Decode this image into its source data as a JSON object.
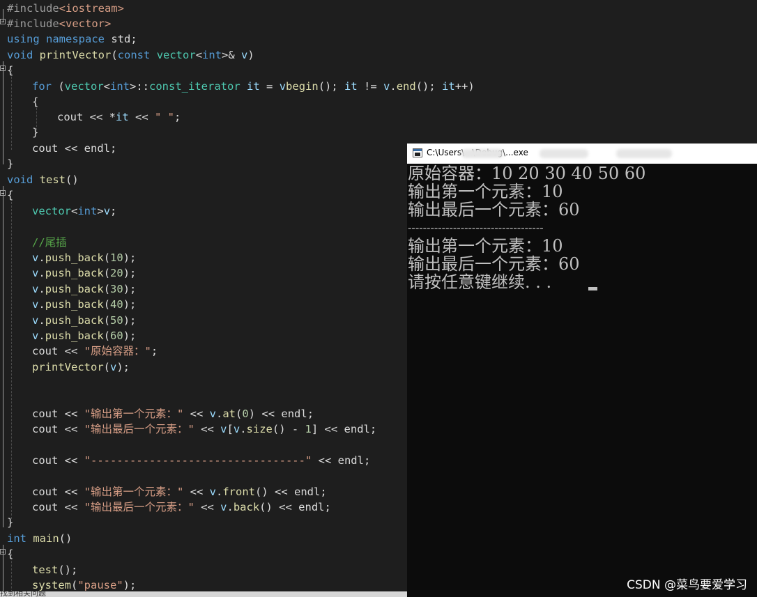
{
  "editor": {
    "line1": {
      "pp": "#include",
      "inc": "<iostream>"
    },
    "line2": {
      "pp": "#include",
      "inc": "<vector>"
    },
    "line3": {
      "kw1": "using",
      "kw2": "namespace",
      "rest": " std;"
    },
    "line4": {
      "kw": "void",
      "fn": "printVector",
      "p1": "(",
      "kw2": "const",
      "ty": "vector",
      "lt": "<",
      "kw3": "int",
      "gt": ">",
      "amp": "& ",
      "var": "v",
      "p2": ")"
    },
    "line5": {
      "t": "{"
    },
    "line6": {
      "kw": "for",
      "a": " (",
      "ty": "vector",
      "lt": "<",
      "kw2": "int",
      "gt": ">::",
      "ty2": "const_iterator",
      "b": " ",
      "var": "it",
      "c": " = ",
      "v": "v",
      ".": ".",
      "fn": "begin",
      "d": "(); ",
      "var2": "it",
      "e": " != ",
      "v2": "v",
      "f": ".",
      "fn2": "end",
      "g": "(); ",
      "var3": "it",
      "h": "++)"
    },
    "line7": {
      "t": "{"
    },
    "line8": {
      "a": "cout",
      "b": " << *",
      "var": "it",
      "c": " << ",
      "str": "\" \"",
      "d": ";"
    },
    "line9": {
      "t": "}"
    },
    "line10": {
      "a": "cout",
      "b": " << ",
      "c": "endl",
      "d": ";"
    },
    "line11": {
      "t": "}"
    },
    "line12": {
      "kw": "void",
      "fn": "test",
      "a": "()"
    },
    "line13": {
      "t": "{"
    },
    "line14": {
      "ty": "vector",
      "lt": "<",
      "kw": "int",
      "gt": ">",
      "var": "v",
      "a": ";"
    },
    "line15": {
      "cm": "//尾插"
    },
    "push": [
      {
        "v": "v",
        "d": ".",
        "fn": "push_back",
        "a": "(",
        "n": "10",
        "b": ");"
      },
      {
        "v": "v",
        "d": ".",
        "fn": "push_back",
        "a": "(",
        "n": "20",
        "b": ");"
      },
      {
        "v": "v",
        "d": ".",
        "fn": "push_back",
        "a": "(",
        "n": "30",
        "b": ");"
      },
      {
        "v": "v",
        "d": ".",
        "fn": "push_back",
        "a": "(",
        "n": "40",
        "b": ");"
      },
      {
        "v": "v",
        "d": ".",
        "fn": "push_back",
        "a": "(",
        "n": "50",
        "b": ");"
      },
      {
        "v": "v",
        "d": ".",
        "fn": "push_back",
        "a": "(",
        "n": "60",
        "b": ");"
      }
    ],
    "line22": {
      "a": "cout",
      "b": " << ",
      "str": "\"原始容器：\"",
      "c": ";"
    },
    "line23": {
      "fn": "printVector",
      "a": "(",
      "var": "v",
      "b": ");"
    },
    "line26": {
      "a": "cout",
      "b": " << ",
      "str": "\"输出第一个元素：\"",
      "c": " << ",
      "v": "v",
      "d": ".",
      "fn": "at",
      "e": "(",
      "n": "0",
      "f": ") << ",
      "g": "endl",
      "h": ";"
    },
    "line27": {
      "a": "cout",
      "b": " << ",
      "str": "\"输出最后一个元素：\"",
      "c": " << ",
      "v": "v",
      "d": "[",
      "v2": "v",
      "e": ".",
      "fn": "size",
      "f": "() - ",
      "n": "1",
      "g": "] << ",
      "h": "endl",
      "i": ";"
    },
    "line29": {
      "a": "cout",
      "b": " << ",
      "str": "\"---------------------------------\"",
      "c": " << ",
      "d": "endl",
      "e": ";"
    },
    "line31": {
      "a": "cout",
      "b": " << ",
      "str": "\"输出第一个元素：\"",
      "c": " << ",
      "v": "v",
      "d": ".",
      "fn": "front",
      "e": "() << ",
      "f": "endl",
      "g": ";"
    },
    "line32": {
      "a": "cout",
      "b": " << ",
      "str": "\"输出最后一个元素：\"",
      "c": " << ",
      "v": "v",
      "d": ".",
      "fn": "back",
      "e": "() << ",
      "f": "endl",
      "g": ";"
    },
    "line33": {
      "t": "}"
    },
    "line34": {
      "kw": "int",
      "fn": "main",
      "a": "()"
    },
    "line35": {
      "t": "{"
    },
    "line36": {
      "fn": "test",
      "a": "();"
    },
    "line37": {
      "fn": "system",
      "a": "(",
      "str": "\"pause\"",
      "b": ");"
    }
  },
  "status_text": "找到相关问题",
  "console": {
    "title": "C:\\Users\\...\\Debug\\...exe",
    "lines": [
      "原始容器：10 20 30 40 50 60",
      "输出第一个元素：10",
      "输出最后一个元素：60",
      "------------------------------------",
      "输出第一个元素：10",
      "输出最后一个元素：60",
      "请按任意键继续. . . "
    ]
  },
  "watermark": "CSDN @菜鸟要爱学习",
  "colors": {
    "keyword": "#569cd6",
    "type": "#4ec9b0",
    "string": "#d69d85",
    "comment": "#57a64a",
    "function": "#dcdcaa",
    "variable": "#9cdcfe",
    "editor_bg": "#1e1e1e",
    "console_bg": "#0c0c0c"
  }
}
